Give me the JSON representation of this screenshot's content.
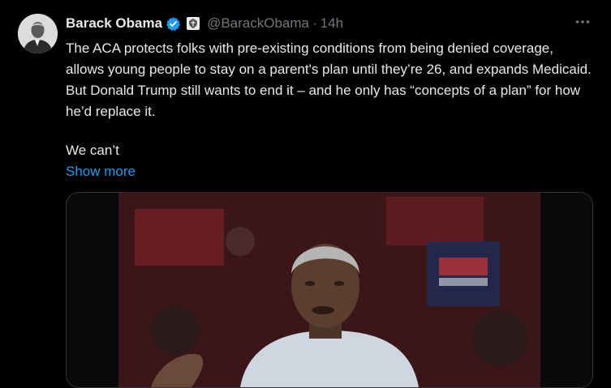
{
  "tweet": {
    "author_name": "Barack Obama",
    "handle": "@BarackObama",
    "separator": "·",
    "time": "14h",
    "text_p1": "The ACA protects folks with pre-existing conditions from being denied coverage, allows young people to stay on a parent's plan until they’re 26, and expands Medicaid. But Donald Trump still wants to end it – and he only has “concepts of a plan” for how he’d replace it.",
    "text_p2": "We can’t",
    "show_more": "Show more"
  },
  "icons": {
    "verified": "verified-badge-icon",
    "affiliation": "us-government-seal-icon",
    "more": "more-horizontal-icon"
  },
  "colors": {
    "background": "#000000",
    "text": "#e7e9ea",
    "muted": "#71767b",
    "link": "#1d9bf0",
    "verified": "#1d9bf0"
  }
}
